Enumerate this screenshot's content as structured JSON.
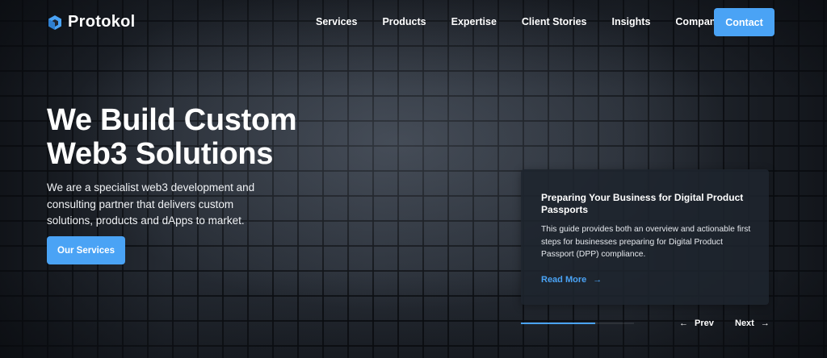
{
  "brand": {
    "name": "Protokol",
    "accent_color": "#4aa3f5",
    "logo_icon": "hexagon-logo-icon"
  },
  "nav": {
    "items": [
      {
        "label": "Services"
      },
      {
        "label": "Products"
      },
      {
        "label": "Expertise"
      },
      {
        "label": "Client Stories"
      },
      {
        "label": "Insights"
      },
      {
        "label": "Company"
      }
    ],
    "contact_label": "Contact"
  },
  "hero": {
    "title_line1": "We Build Custom",
    "title_line2": "Web3 Solutions",
    "subtitle": "We are a specialist web3 development and consulting partner that delivers custom solutions, products and dApps to market.",
    "cta_label": "Our Services"
  },
  "card": {
    "title": "Preparing Your Business for Digital Product Passports",
    "body": "This guide provides both an overview and actionable first steps for businesses preparing for Digital Product Passport (DPP) compliance.",
    "link_label": "Read More",
    "link_icon": "arrow-right-icon"
  },
  "slider": {
    "progress": 0.66,
    "prev_label": "Prev",
    "next_label": "Next",
    "prev_icon": "arrow-left-icon",
    "next_icon": "arrow-right-icon"
  }
}
